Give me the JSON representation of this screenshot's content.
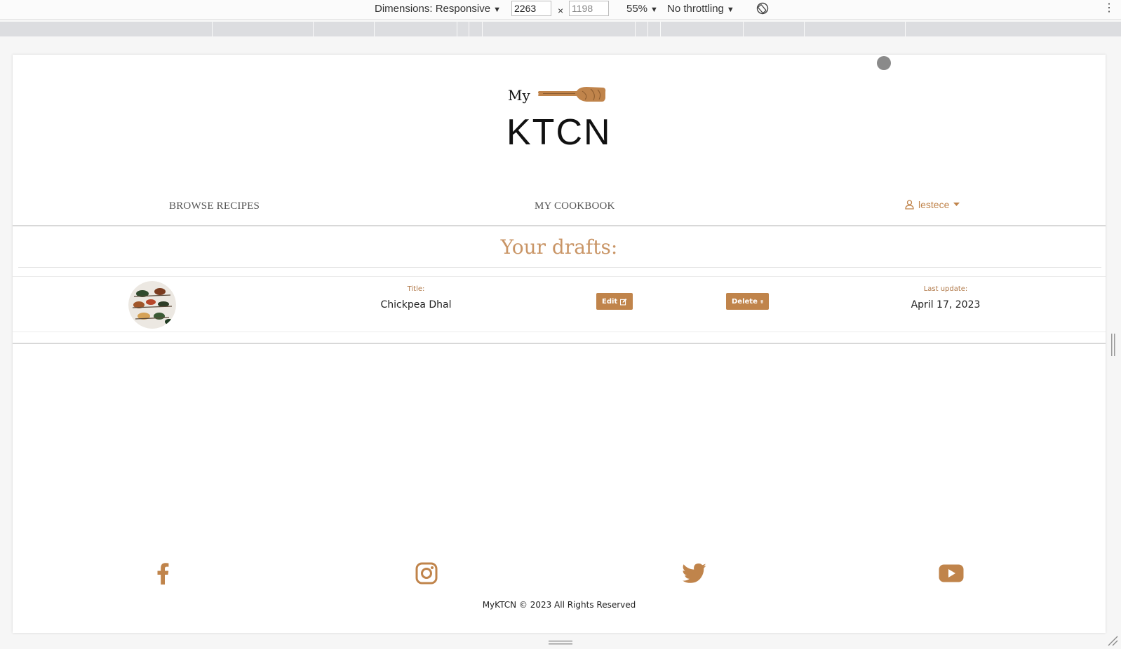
{
  "devtools": {
    "dimensions_label": "Dimensions: Responsive",
    "width_value": "2263",
    "height_placeholder": "1198",
    "times": "×",
    "zoom": "55%",
    "throttling": "No throttling",
    "caret": "▼",
    "kebab": "⋮"
  },
  "site": {
    "logo_small": "My",
    "logo_big": "KTCN",
    "nav": {
      "browse": "BROWSE RECIPES",
      "cookbook": "MY COOKBOOK",
      "username": "lestece"
    },
    "drafts_heading": "Your drafts:",
    "drafts": [
      {
        "title_label": "Title:",
        "title": "Chickpea Dhal",
        "edit_label": "Edit",
        "delete_label": "Delete",
        "updated_label": "Last update:",
        "updated": "April 17, 2023"
      }
    ],
    "footer": "MyKTCN © 2023 All Rights Reserved",
    "social_icons": [
      "facebook-icon",
      "instagram-icon",
      "twitter-icon",
      "youtube-icon"
    ]
  },
  "colors": {
    "accent": "#c0844b",
    "heading": "#c99566"
  }
}
